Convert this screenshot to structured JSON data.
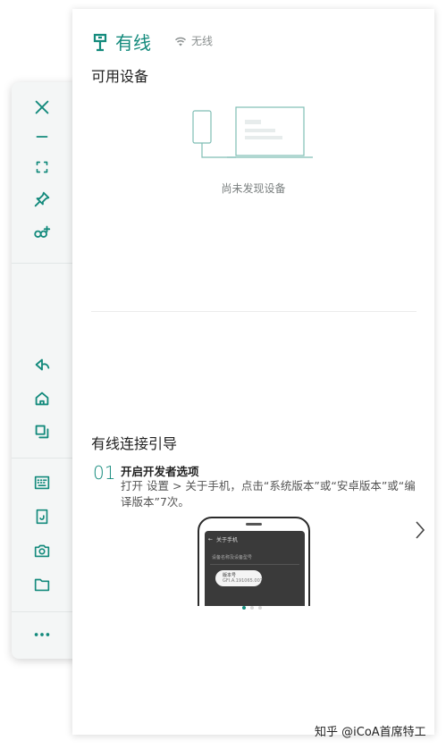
{
  "panel": {
    "tab_wired_label": "有线",
    "tab_wireless_label": "无线",
    "available_devices_title": "可用设备",
    "no_device_text": "尚未发现设备",
    "guide_title": "有线连接引导",
    "step": {
      "number": "01",
      "title": "开启开发者选项",
      "description": "打开 设置 > 关于手机，点击“系统版本”或“安卓版本”或“编译版本”7次。"
    },
    "phone_preview": {
      "header": "关于手机",
      "row_hint": "设备名称及设备型号",
      "pill_title": "版本号",
      "pill_value": "GFI.A.191065.007"
    },
    "carousel": {
      "page_count": 3,
      "active_index": 0
    }
  },
  "toolbar": {
    "top_icons": [
      "close-icon",
      "minimize-icon",
      "fullscreen-icon",
      "pin-icon",
      "link-add-icon"
    ],
    "nav_icons": [
      "back-icon",
      "home-icon",
      "recent-apps-icon"
    ],
    "tool_icons": [
      "keyboard-icon",
      "screen-rotate-icon",
      "screenshot-icon",
      "folder-icon"
    ],
    "more_label": "..."
  },
  "watermark": {
    "text": "知乎 @iCoA首席特工"
  },
  "colors": {
    "accent": "#138a7c",
    "muted": "#8a8f8f",
    "toolbar_bg": "#f4f6f6"
  }
}
